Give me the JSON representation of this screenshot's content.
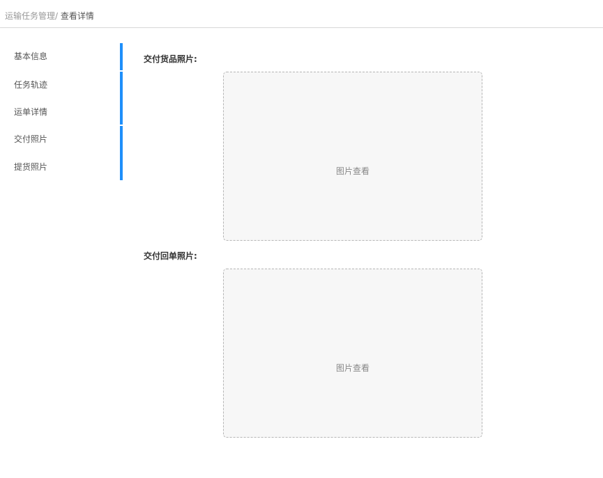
{
  "breadcrumb": {
    "parent": "运输任务管理",
    "separator": "/",
    "current": "查看详情"
  },
  "sidebar": {
    "items": [
      {
        "label": "基本信息"
      },
      {
        "label": "任务轨迹"
      },
      {
        "label": "运单详情"
      },
      {
        "label": "交付照片"
      },
      {
        "label": "提货照片"
      }
    ],
    "indicator_color": "#1e8ffa"
  },
  "sections": [
    {
      "label": "交付货品照片:",
      "placeholder": "图片查看"
    },
    {
      "label": "交付回单照片:",
      "placeholder": "图片查看"
    }
  ]
}
